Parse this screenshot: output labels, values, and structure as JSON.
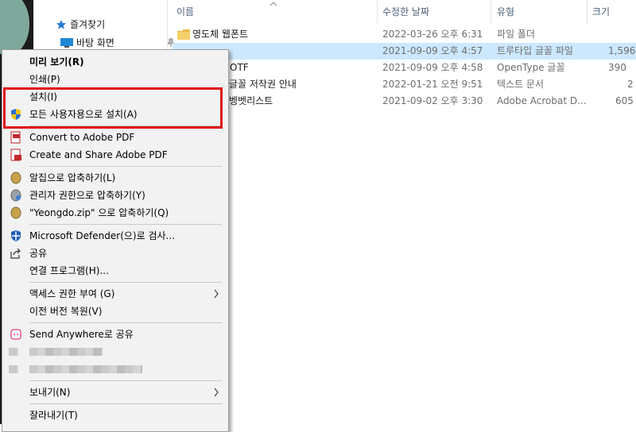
{
  "nav": {
    "quick_access": "즐겨찾기",
    "desktop": "바탕 화면"
  },
  "columns": {
    "name": "이름",
    "modified": "수정한 날짜",
    "type": "유형",
    "size": "크기"
  },
  "files": [
    {
      "name": "영도체 웹폰트",
      "modified": "2022-03-26 오후 6:31",
      "type": "파일 폴더",
      "size": "",
      "selected": false
    },
    {
      "name": "",
      "modified": "2021-09-09 오후 4:57",
      "type": "트루타입 글꼴 파일",
      "size": "1,596",
      "selected": true
    },
    {
      "name": "OTF",
      "modified": "2021-09-09 오후 4:58",
      "type": "OpenType 글꼴",
      "size": "390",
      "selected": false
    },
    {
      "name": "글꼴 저작권 안내",
      "modified": "2022-01-21 오전 9:51",
      "type": "텍스트 문서",
      "size": "2",
      "selected": false
    },
    {
      "name": "벵벳리스트",
      "modified": "2021-09-02 오후 3:30",
      "type": "Adobe Acrobat D...",
      "size": "605",
      "selected": false
    }
  ],
  "context_menu": {
    "preview": "미리 보기(R)",
    "print": "인쇄(P)",
    "install": "설치(I)",
    "install_all_users": "모든 사용자용으로 설치(A)",
    "convert_pdf": "Convert to Adobe PDF",
    "create_share_pdf": "Create and Share Adobe PDF",
    "alzip_compress": "알집으로 압축하기(L)",
    "admin_compress": "관리자 권한으로 압축하기(Y)",
    "zip_compress": "\"Yeongdo.zip\" 으로 압축하기(Q)",
    "defender_scan": "Microsoft Defender(으)로 검사...",
    "share": "공유",
    "open_with": "연결 프로그램(H)...",
    "give_access": "액세스 권한 부여 (G)",
    "restore_versions": "이전 버전 복원(V)",
    "send_anywhere": "Send Anywhere로 공유",
    "send_to": "보내기(N)",
    "cut": "잘라내기(T)"
  },
  "colors": {
    "highlight_box": "#e01010",
    "selected_row": "#cce8ff",
    "menu_bg": "#f2f2f2"
  }
}
